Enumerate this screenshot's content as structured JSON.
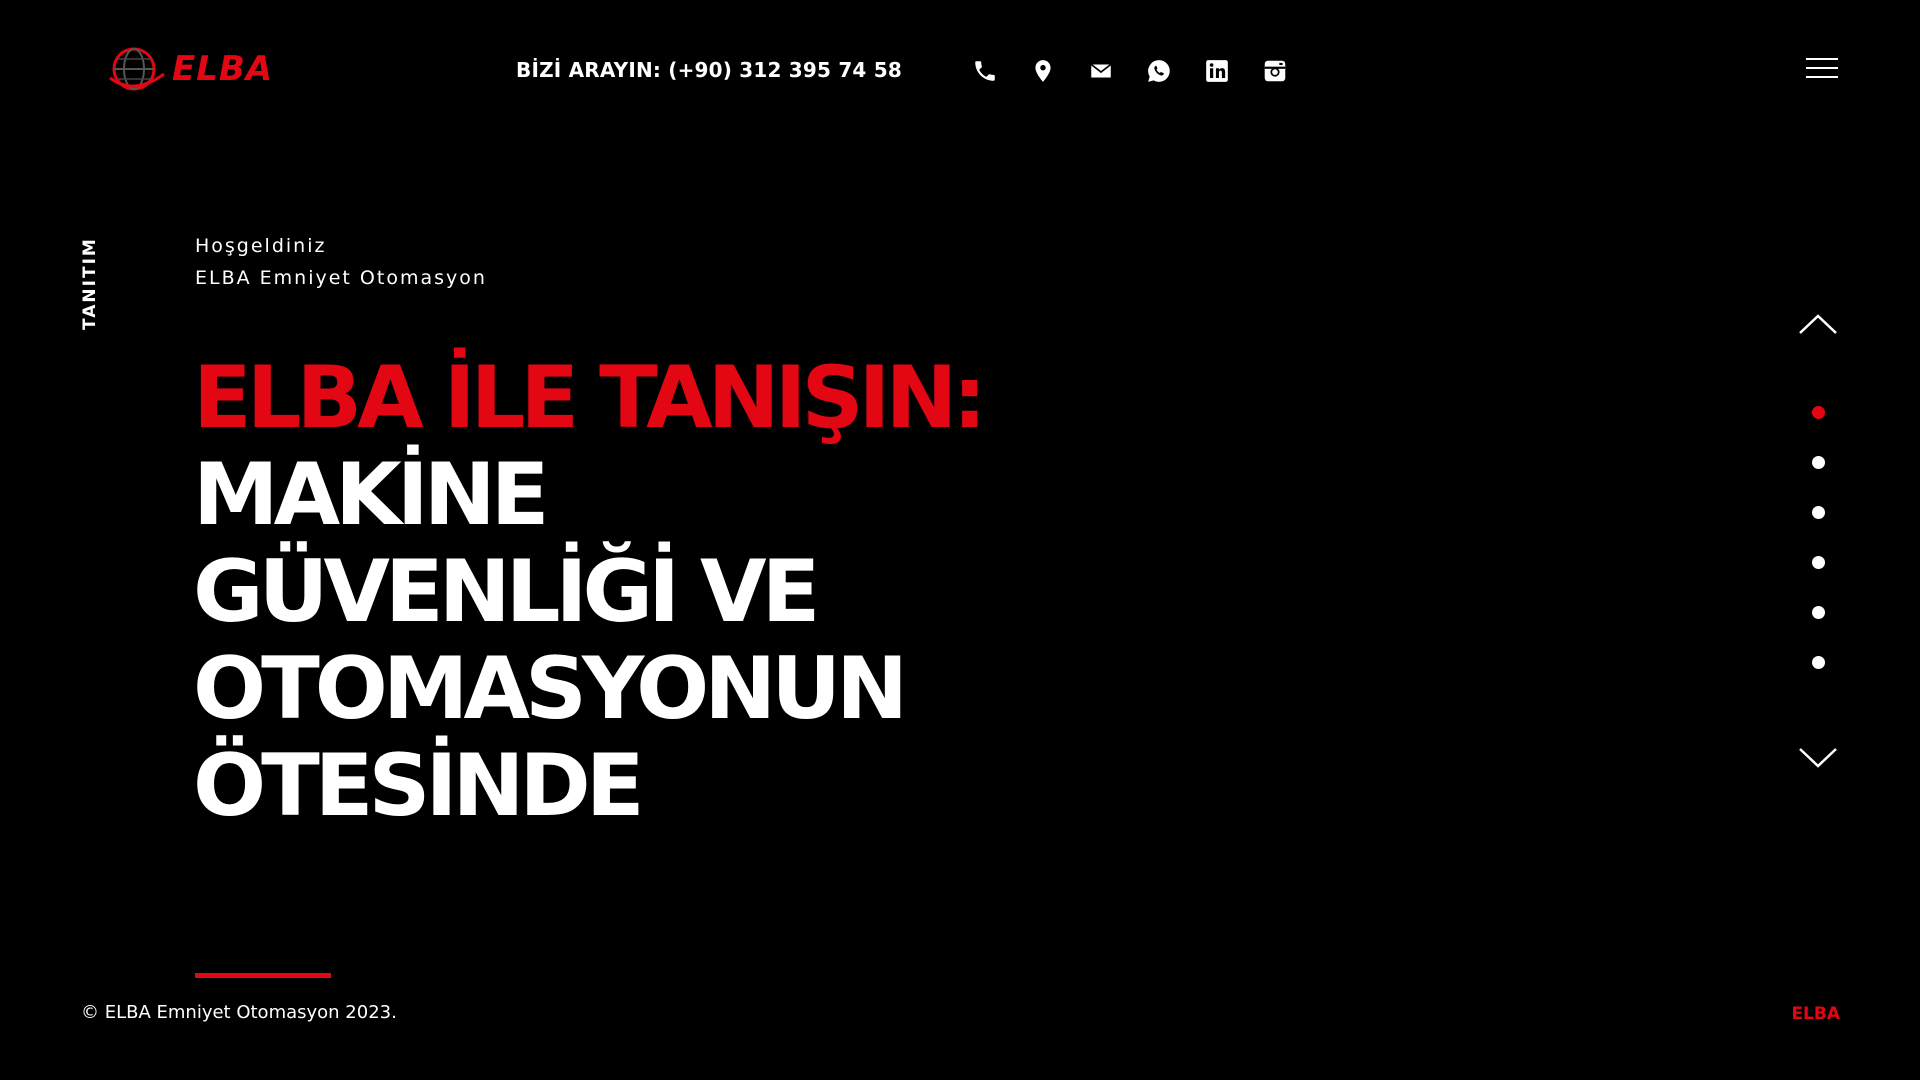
{
  "header": {
    "logo_text": "ELBA",
    "call_text": "BİZİ ARAYIN: (+90) 312 395 74 58",
    "social_icons": [
      "phone-icon",
      "location-pin-icon",
      "mail-icon",
      "whatsapp-icon",
      "linkedin-icon",
      "instagram-icon"
    ],
    "menu_icon": "hamburger-menu-icon"
  },
  "side_label": "TANITIM",
  "intro": {
    "line1": "Hoşgeldiniz",
    "line2": "ELBA Emniyet Otomasyon"
  },
  "headline": {
    "red": "ELBA İLE TANIŞIN:",
    "lines": [
      "MAKİNE",
      "GÜVENLİĞİ VE",
      "OTOMASYONUN",
      "ÖTESİNDE"
    ]
  },
  "slider": {
    "total_slides": 6,
    "active_index": 0
  },
  "footer": {
    "copyright": "© ELBA Emniyet Otomasyon 2023.",
    "brand": "ELBA"
  },
  "colors": {
    "background": "#000000",
    "accent": "#e30613",
    "text": "#ffffff"
  }
}
